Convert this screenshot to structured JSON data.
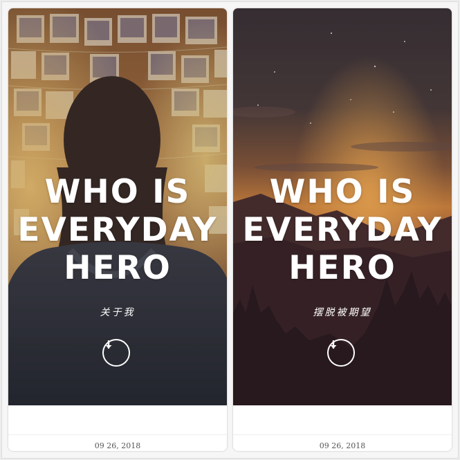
{
  "cards": [
    {
      "headline": [
        "WHO IS",
        "EVERYDAY",
        "HERO"
      ],
      "subtitle": "关于我",
      "scroll_icon": "arrow-down-icon",
      "date": "09 26, 2018"
    },
    {
      "headline": [
        "WHO IS",
        "EVERYDAY",
        "HERO"
      ],
      "subtitle": "摆脱被期望",
      "scroll_icon": "arrow-down-icon",
      "date": "09 26, 2018"
    }
  ],
  "colors": {
    "overlay_text": "#ffffff",
    "card_background": "#ffffff",
    "date_text": "#555555"
  }
}
